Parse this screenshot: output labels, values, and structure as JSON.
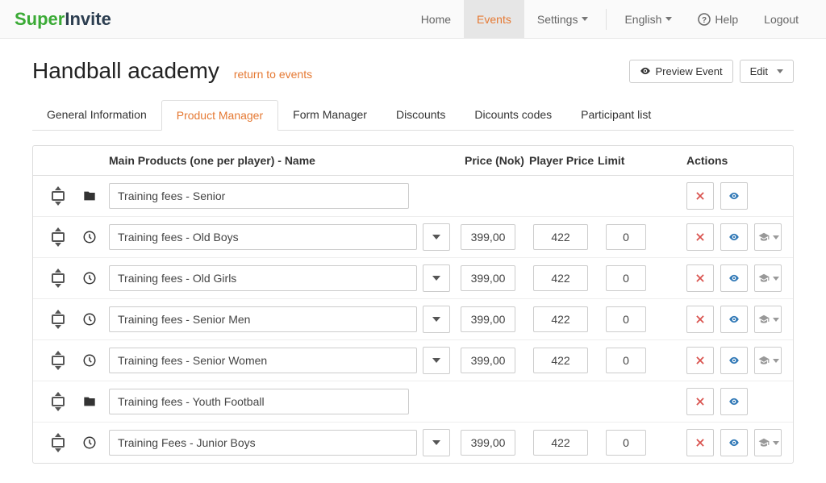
{
  "brand": {
    "part1": "Super",
    "part2": "Invite"
  },
  "nav": {
    "home": "Home",
    "events": "Events",
    "settings": "Settings",
    "language": "English",
    "help": "Help",
    "logout": "Logout"
  },
  "page": {
    "title": "Handball academy",
    "return": "return to events",
    "preview": "Preview Event",
    "edit": "Edit"
  },
  "tabs": {
    "general": "General Information",
    "product": "Product Manager",
    "form": "Form Manager",
    "discounts": "Discounts",
    "codes": "Dicounts codes",
    "participants": "Participant list"
  },
  "tableHead": {
    "name": "Main Products (one per player) - Name",
    "price": "Price (Nok)",
    "pprice": "Player Price",
    "limit": "Limit",
    "actions": "Actions"
  },
  "rows": [
    {
      "type": "group",
      "name": "Training fees - Senior"
    },
    {
      "type": "item",
      "name": "Training fees - Old Boys",
      "price": "399,00",
      "pprice": "422",
      "limit": "0"
    },
    {
      "type": "item",
      "name": "Training fees - Old Girls",
      "price": "399,00",
      "pprice": "422",
      "limit": "0"
    },
    {
      "type": "item",
      "name": "Training fees - Senior Men",
      "price": "399,00",
      "pprice": "422",
      "limit": "0"
    },
    {
      "type": "item",
      "name": "Training fees - Senior Women",
      "price": "399,00",
      "pprice": "422",
      "limit": "0"
    },
    {
      "type": "group",
      "name": "Training fees - Youth Football"
    },
    {
      "type": "item",
      "name": "Training Fees - Junior Boys",
      "price": "399,00",
      "pprice": "422",
      "limit": "0"
    }
  ]
}
